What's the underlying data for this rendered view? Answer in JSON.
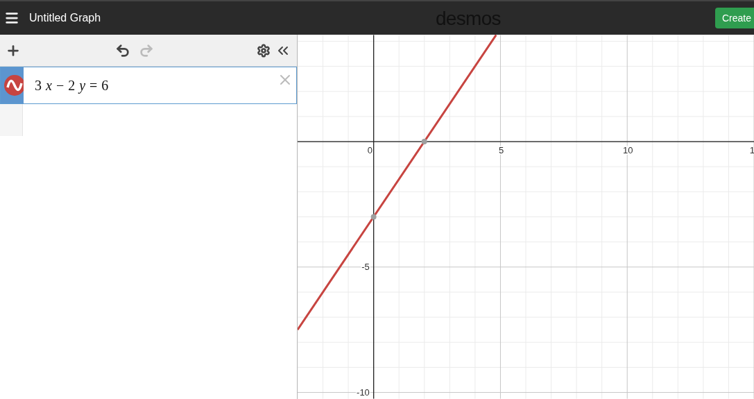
{
  "header": {
    "title": "Untitled Graph",
    "logo": "desmos",
    "create_button": "Create"
  },
  "expressions": [
    {
      "parts": [
        {
          "text": "3",
          "italic": false
        },
        {
          "text": "x",
          "italic": true
        },
        {
          "text": "−",
          "italic": false
        },
        {
          "text": "2",
          "italic": false
        },
        {
          "text": "y",
          "italic": true
        },
        {
          "text": "=",
          "italic": false
        },
        {
          "text": "6",
          "italic": false
        }
      ],
      "color": "#c74440",
      "selected": true
    }
  ],
  "graph": {
    "edge_label": "1",
    "chart_data": {
      "type": "line",
      "grid": true,
      "xlim": [
        -3,
        15
      ],
      "ylim": [
        -10.25,
        4.25
      ],
      "xticks": [
        {
          "value": 0,
          "label": "0"
        },
        {
          "value": 5,
          "label": "5"
        },
        {
          "value": 10,
          "label": "10"
        }
      ],
      "yticks": [
        {
          "value": -5,
          "label": "-5"
        },
        {
          "value": -10,
          "label": "-10"
        }
      ],
      "x": [
        -3,
        4.83
      ],
      "series": [
        {
          "color": "#c74440",
          "values": [
            -7.5,
            4.25
          ]
        }
      ]
    }
  }
}
